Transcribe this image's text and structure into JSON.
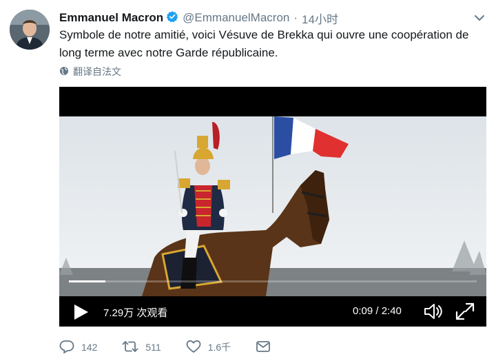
{
  "tweet": {
    "author_name": "Emmanuel Macron",
    "handle": "@EmmanuelMacron",
    "separator": "·",
    "time": "14小时",
    "text": "Symbole de notre amitié, voici Vésuve de Brekka qui ouvre une coopération de long terme avec notre Garde républicaine.",
    "translate_label": "翻译自法文"
  },
  "video": {
    "views": "7.29万 次观看",
    "time": "0:09 / 2:40",
    "progress": 0.09
  },
  "actions": {
    "replies": "142",
    "retweets": "511",
    "likes": "1.6千"
  },
  "colors": {
    "verified": "#1da1f2",
    "muted": "#657786",
    "flag_blue": "#2b4ea2",
    "flag_red": "#e03030"
  },
  "icons": [
    "verified-badge-icon",
    "chevron-down-icon",
    "globe-icon",
    "play-icon",
    "volume-icon",
    "expand-icon",
    "reply-icon",
    "retweet-icon",
    "like-icon",
    "direct-message-icon"
  ]
}
